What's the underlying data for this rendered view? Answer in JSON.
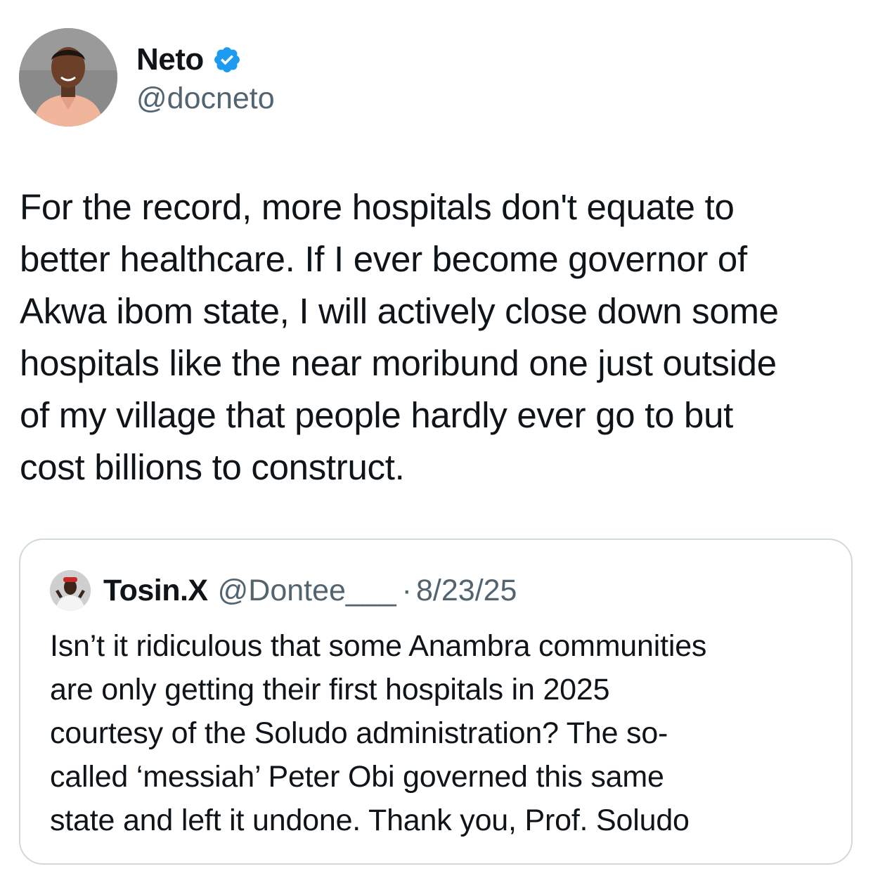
{
  "author": {
    "display_name": "Neto",
    "handle": "@docneto",
    "verified": true,
    "avatar_icon": "profile-photo",
    "verified_color": "#1d9bf0"
  },
  "tweet": {
    "text": "For the record, more hospitals don't equate to\nbetter healthcare. If I ever become governor of\nAkwa ibom state, I will actively close down some\nhospitals like the near moribund one just outside\nof my village that people hardly ever go to but\ncost billions to construct."
  },
  "quoted_tweet": {
    "display_name": "Tosin.X",
    "handle": "@Dontee___",
    "separator": "·",
    "date": "8/23/25",
    "avatar_icon": "profile-photo",
    "text": "Isn’t it ridiculous that some Anambra communities\nare only getting their first hospitals in 2025\ncourtesy of the Soludo administration? The so-\ncalled ‘messiah’ Peter Obi governed this same\nstate and left it undone. Thank you, Prof. Soludo"
  },
  "colors": {
    "text_primary": "#0f1419",
    "text_secondary": "#536471",
    "border": "#cfd9de"
  }
}
